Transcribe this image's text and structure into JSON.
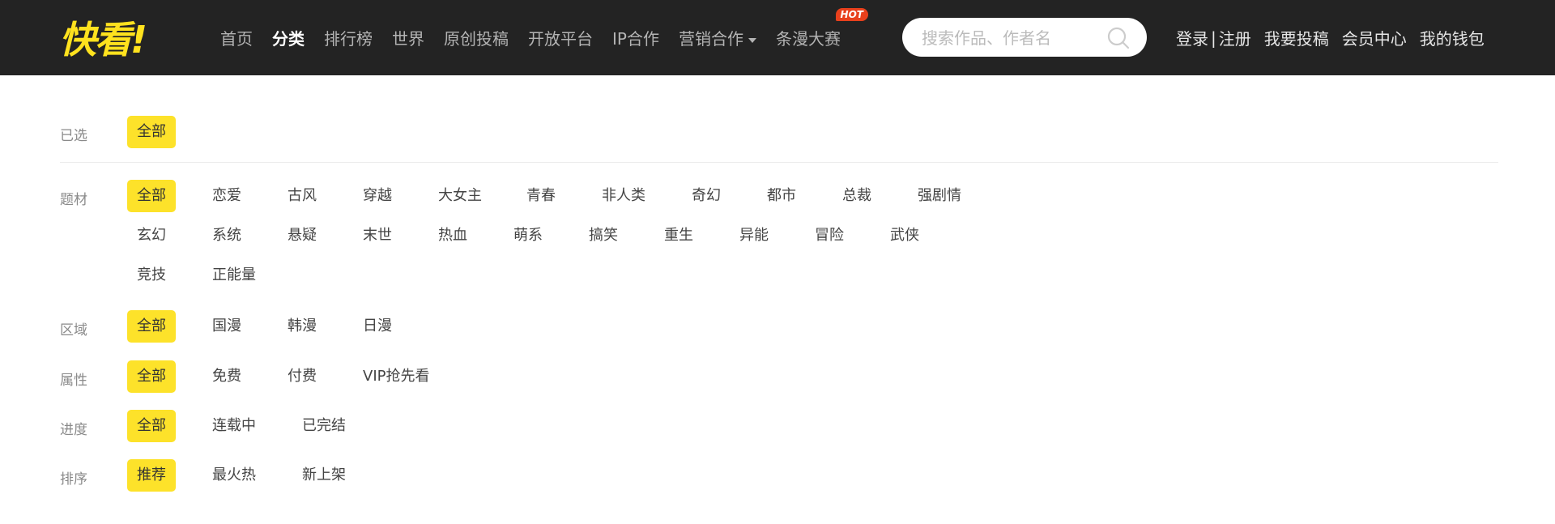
{
  "header": {
    "logo_text": "快看!",
    "nav": [
      {
        "label": "首页"
      },
      {
        "label": "分类",
        "active": true
      },
      {
        "label": "排行榜"
      },
      {
        "label": "世界"
      },
      {
        "label": "原创投稿"
      },
      {
        "label": "开放平台"
      },
      {
        "label": "IP合作"
      },
      {
        "label": "营销合作",
        "dropdown": true
      },
      {
        "label": "条漫大赛",
        "badge": "HOT"
      }
    ],
    "search": {
      "placeholder": "搜索作品、作者名"
    },
    "login": "登录",
    "separator": "|",
    "register": "注册",
    "submit": "我要投稿",
    "member": "会员中心",
    "wallet": "我的钱包"
  },
  "colors": {
    "topbar": "#232323",
    "accent": "#fde22a",
    "hot": "#e8401c"
  },
  "filters": {
    "selected": {
      "label": "已选",
      "tags": [
        "全部"
      ]
    },
    "theme": {
      "label": "题材",
      "tags": [
        "全部",
        "恋爱",
        "古风",
        "穿越",
        "大女主",
        "青春",
        "非人类",
        "奇幻",
        "都市",
        "总裁",
        "强剧情",
        "玄幻",
        "系统",
        "悬疑",
        "末世",
        "热血",
        "萌系",
        "搞笑",
        "重生",
        "异能",
        "冒险",
        "武侠",
        "竞技",
        "正能量"
      ]
    },
    "region": {
      "label": "区域",
      "tags": [
        "全部",
        "国漫",
        "韩漫",
        "日漫"
      ]
    },
    "attribute": {
      "label": "属性",
      "tags": [
        "全部",
        "免费",
        "付费",
        "VIP抢先看"
      ]
    },
    "progress": {
      "label": "进度",
      "tags": [
        "全部",
        "连载中",
        "已完结"
      ]
    },
    "sort": {
      "label": "排序",
      "tags": [
        "推荐",
        "最火热",
        "新上架"
      ]
    }
  }
}
